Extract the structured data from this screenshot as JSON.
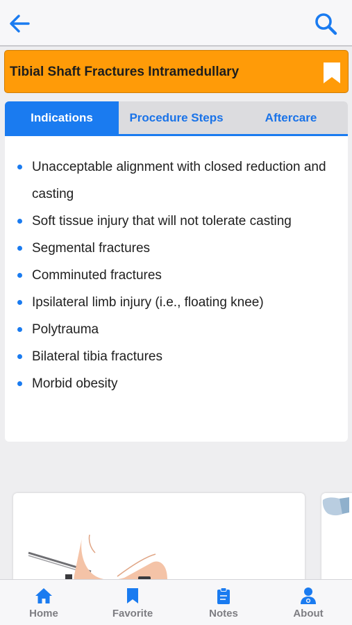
{
  "header": {
    "back_icon": "arrow-left-icon",
    "search_icon": "search-icon",
    "accent_color": "#1a7bf0"
  },
  "title_bar": {
    "title": "Tibial Shaft Fractures Intramedullary",
    "bookmark_icon": "bookmark-icon",
    "background_color": "#ff9b08"
  },
  "tabs": [
    {
      "label": "Indications",
      "active": true
    },
    {
      "label": "Procedure Steps",
      "active": false
    },
    {
      "label": "Aftercare",
      "active": false
    }
  ],
  "indications": [
    "Unacceptable alignment with closed reduction and casting",
    "Soft tissue injury that will not tolerate casting",
    "Segmental fractures",
    "Comminuted fractures",
    "Ipsilateral limb injury (i.e., floating knee)",
    "Polytrauma",
    "Bilateral tibia fractures",
    "Morbid obesity"
  ],
  "bottom_nav": [
    {
      "label": "Home",
      "icon": "home-icon"
    },
    {
      "label": "Favorite",
      "icon": "bookmark-icon"
    },
    {
      "label": "Notes",
      "icon": "clipboard-icon"
    },
    {
      "label": "About",
      "icon": "doctor-icon"
    }
  ]
}
